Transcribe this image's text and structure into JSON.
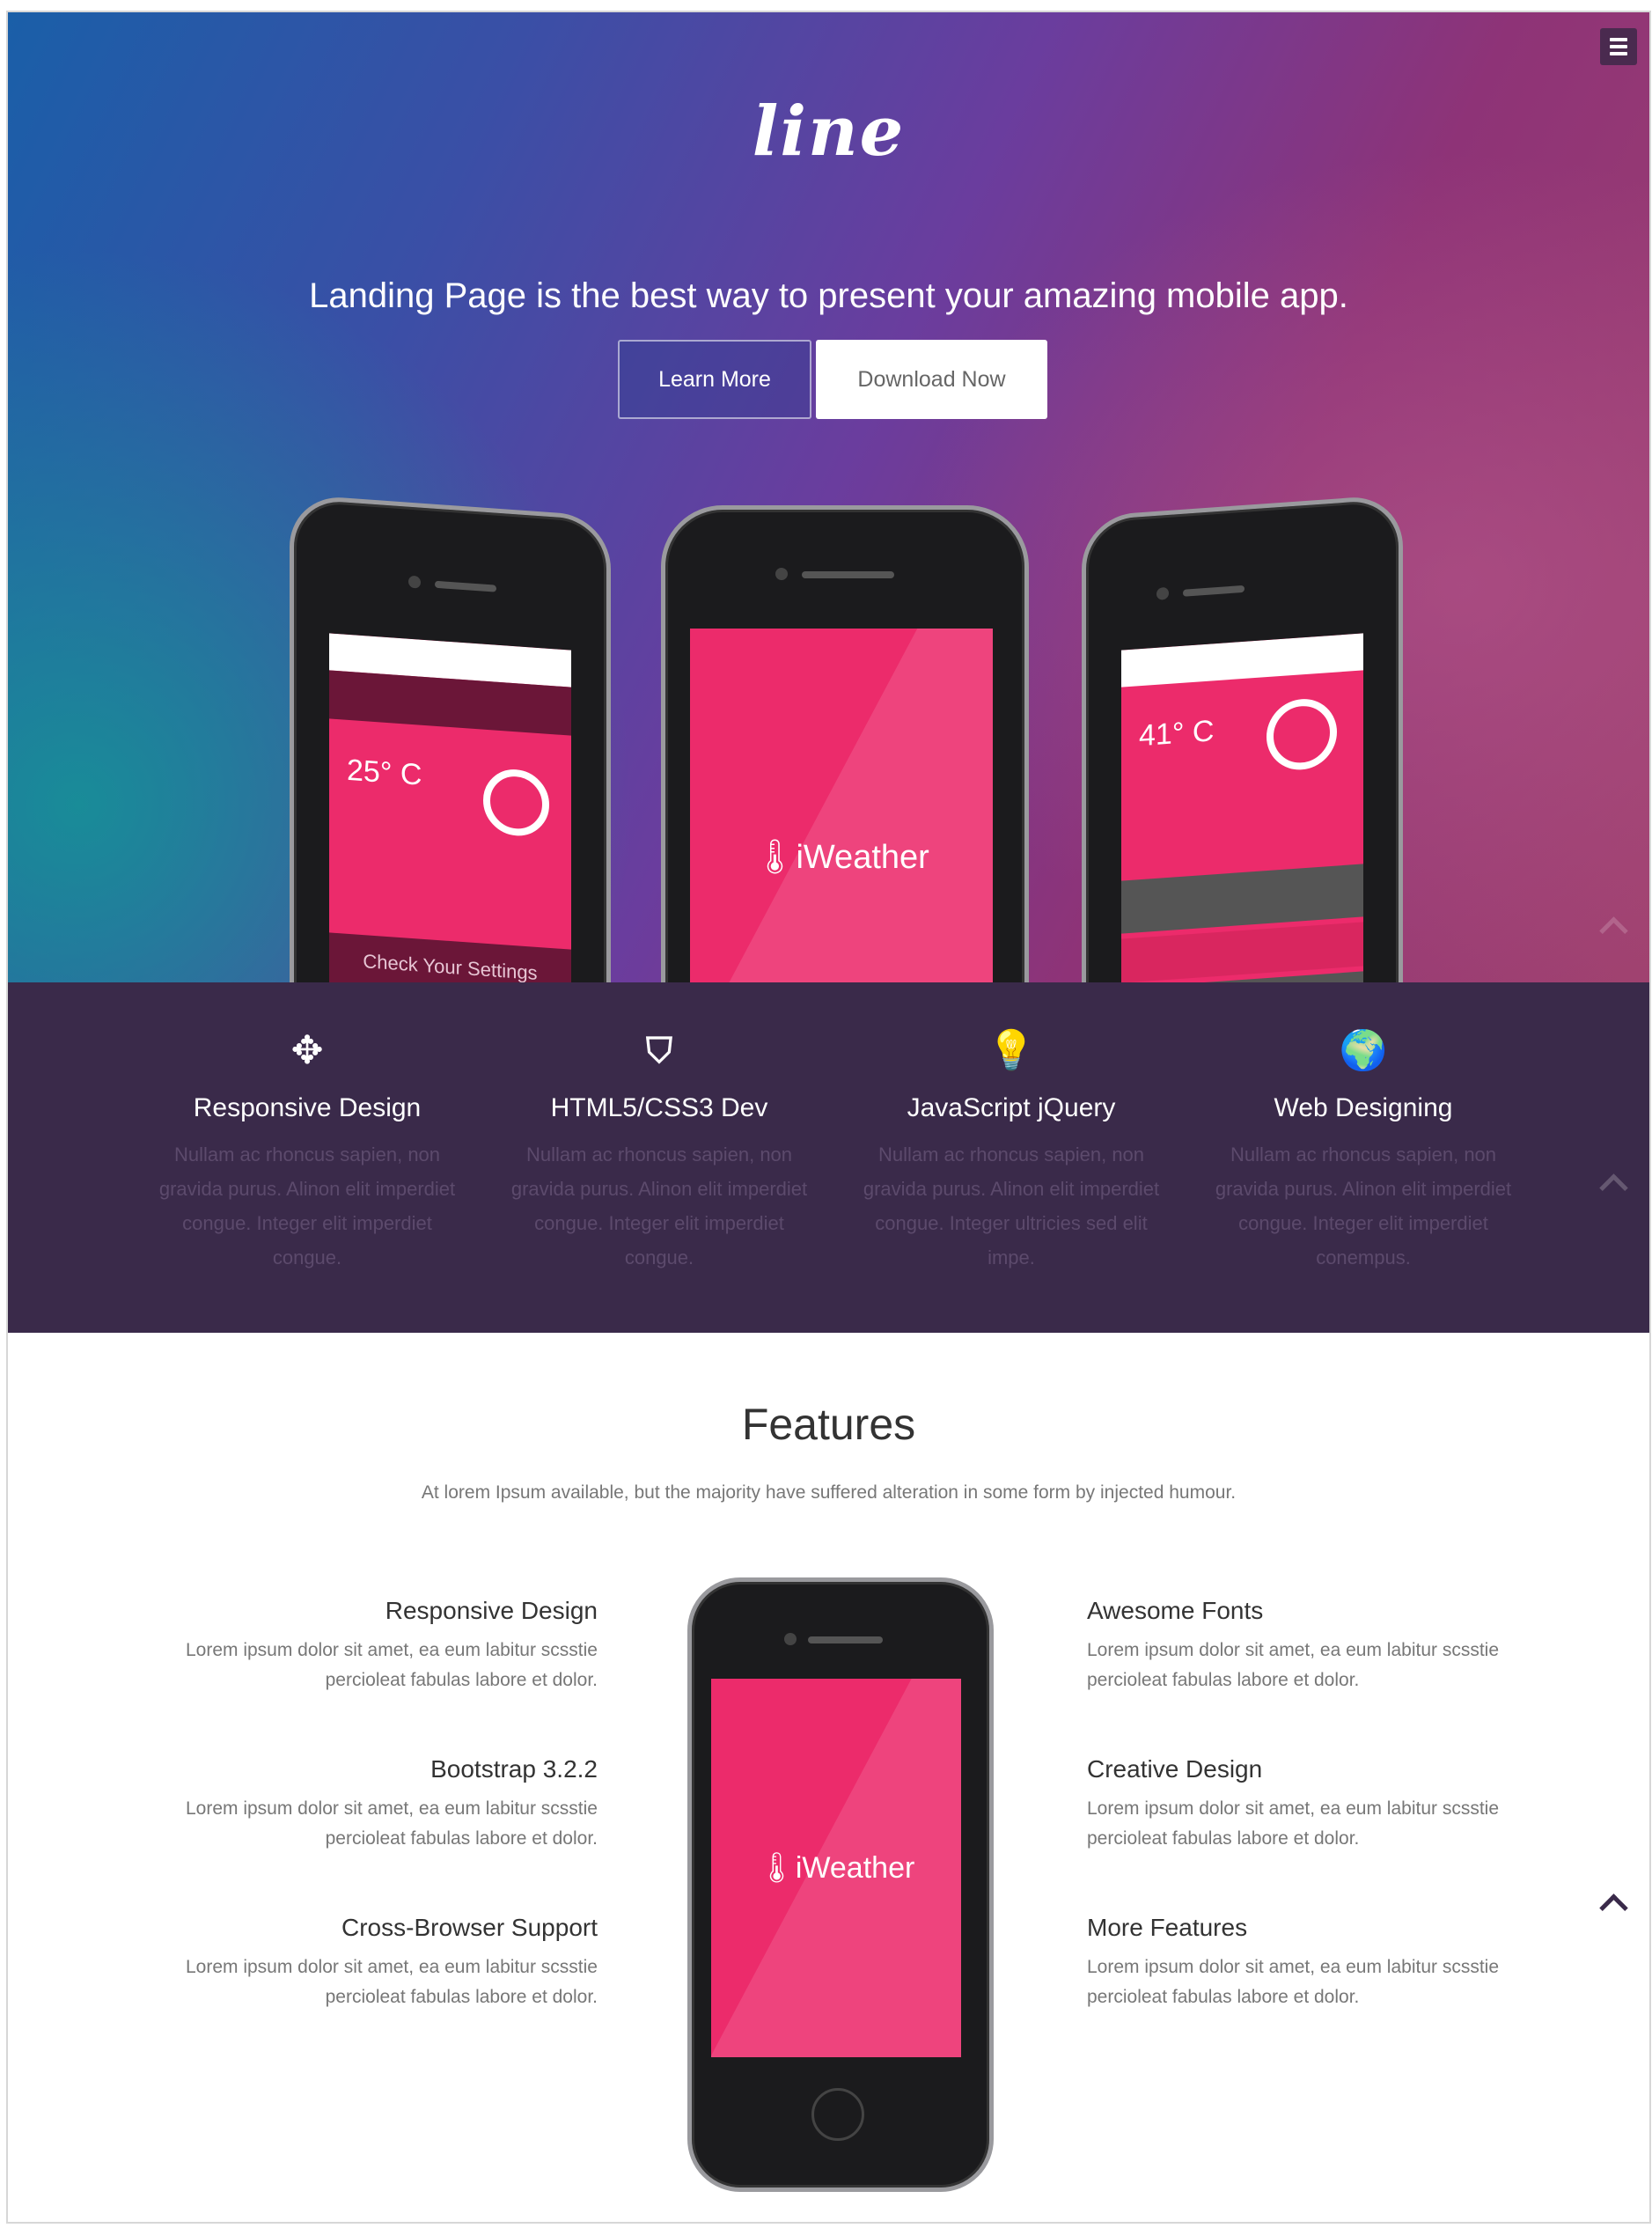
{
  "app": {
    "logo": "line",
    "tagline": "Landing Page is the best way to present your amazing mobile app.",
    "buttons": {
      "learn_more": "Learn More",
      "download_now": "Download Now"
    },
    "menu_icon": "hamburger-icon"
  },
  "phones": {
    "brand": "iWeather",
    "left": {
      "temp": "25° C",
      "footer": "Check Your Settings"
    },
    "right": {
      "temp": "41° C"
    }
  },
  "services": [
    {
      "icon": "move-icon",
      "title": "Responsive Design",
      "text": "Nullam ac rhoncus sapien, non gravida purus. Alinon elit imperdiet congue. Integer elit imperdiet congue."
    },
    {
      "icon": "html5-icon",
      "title": "HTML5/CSS3 Dev",
      "text": "Nullam ac rhoncus sapien, non gravida purus. Alinon elit imperdiet congue. Integer elit imperdiet congue."
    },
    {
      "icon": "lightbulb-icon",
      "title": "JavaScript jQuery",
      "text": "Nullam ac rhoncus sapien, non gravida purus. Alinon elit imperdiet congue. Integer ultricies sed elit impe."
    },
    {
      "icon": "globe-icon",
      "title": "Web Designing",
      "text": "Nullam ac rhoncus sapien, non gravida purus. Alinon elit imperdiet congue. Integer elit imperdiet conempus."
    }
  ],
  "features": {
    "title": "Features",
    "subtitle": "At lorem Ipsum available, but the majority have suffered alteration in some form by injected humour.",
    "left": [
      {
        "title": "Responsive Design",
        "text": "Lorem ipsum dolor sit amet, ea eum labitur scsstie percioleat fabulas labore et dolor."
      },
      {
        "title": "Bootstrap 3.2.2",
        "text": "Lorem ipsum dolor sit amet, ea eum labitur scsstie percioleat fabulas labore et dolor."
      },
      {
        "title": "Cross-Browser Support",
        "text": "Lorem ipsum dolor sit amet, ea eum labitur scsstie percioleat fabulas labore et dolor."
      }
    ],
    "right": [
      {
        "title": "Awesome Fonts",
        "text": "Lorem ipsum dolor sit amet, ea eum labitur scsstie percioleat fabulas labore et dolor."
      },
      {
        "title": "Creative Design",
        "text": "Lorem ipsum dolor sit amet, ea eum labitur scsstie percioleat fabulas labore et dolor."
      },
      {
        "title": "More Features",
        "text": "Lorem ipsum dolor sit amet, ea eum labitur scsstie percioleat fabulas labore et dolor."
      }
    ]
  },
  "colors": {
    "band": "#3a2a4a",
    "phone_screen": "#ec2b6b",
    "band_text": "#5c4a6c"
  }
}
